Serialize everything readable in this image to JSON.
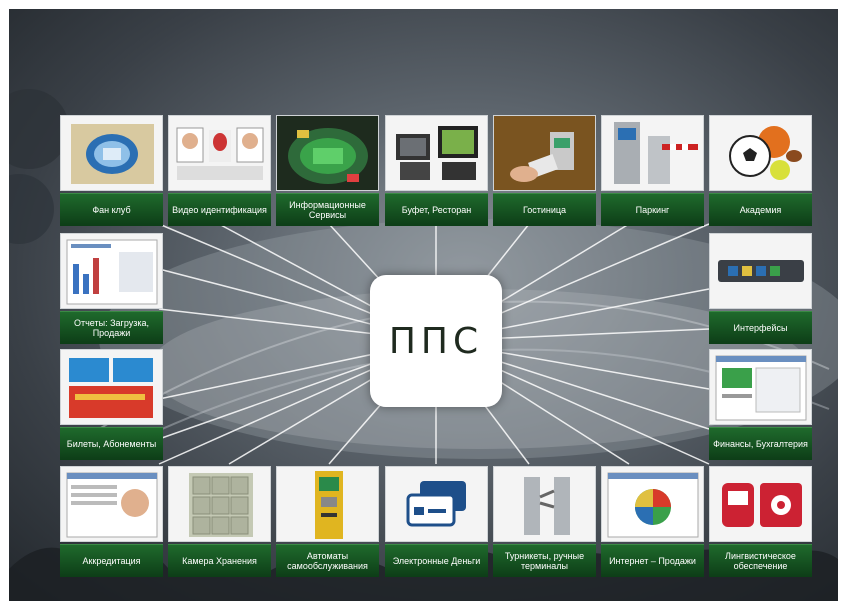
{
  "center": {
    "label": "ППС"
  },
  "tiles": {
    "fan_club": {
      "label": "Фан клуб",
      "icon": "fan-club-badge-icon"
    },
    "video_id": {
      "label": "Видео идентификация",
      "icon": "face-id-icon"
    },
    "info_services": {
      "label": "Информационные Сервисы",
      "icon": "stadium-map-icon"
    },
    "buffet": {
      "label": "Буфет, Ресторан",
      "icon": "pos-terminal-icon"
    },
    "hotel": {
      "label": "Гостиница",
      "icon": "key-card-icon"
    },
    "parking": {
      "label": "Паркинг",
      "icon": "parking-barrier-icon"
    },
    "academy": {
      "label": "Академия",
      "icon": "sports-balls-icon"
    },
    "reports": {
      "label": "Отчеты: Загрузка, Продажи",
      "icon": "report-chart-icon"
    },
    "interfaces": {
      "label": "Интерфейсы",
      "icon": "network-switch-icon"
    },
    "tickets": {
      "label": "Билеты, Абонементы",
      "icon": "ticket-icon"
    },
    "finance": {
      "label": "Финансы, Бухгалтерия",
      "icon": "accounting-window-icon"
    },
    "accreditation": {
      "label": "Аккредитация",
      "icon": "id-badge-icon"
    },
    "storage": {
      "label": "Камера Хранения",
      "icon": "lockers-icon"
    },
    "kiosks": {
      "label": "Автоматы самообслуживания",
      "icon": "kiosk-icon"
    },
    "e_money": {
      "label": "Электронные Деньги",
      "icon": "credit-cards-icon"
    },
    "turnstiles": {
      "label": "Турникеты, ручные терминалы",
      "icon": "turnstile-icon"
    },
    "internet_sales": {
      "label": "Интернет – Продажи",
      "icon": "web-shop-icon"
    },
    "linguistic": {
      "label": "Лингвистическое обеспечение",
      "icon": "phone-gear-icon"
    }
  },
  "colors": {
    "label_green": "#1f6a2c",
    "background_dark": "#3a4047",
    "line_white": "#ffffff"
  }
}
